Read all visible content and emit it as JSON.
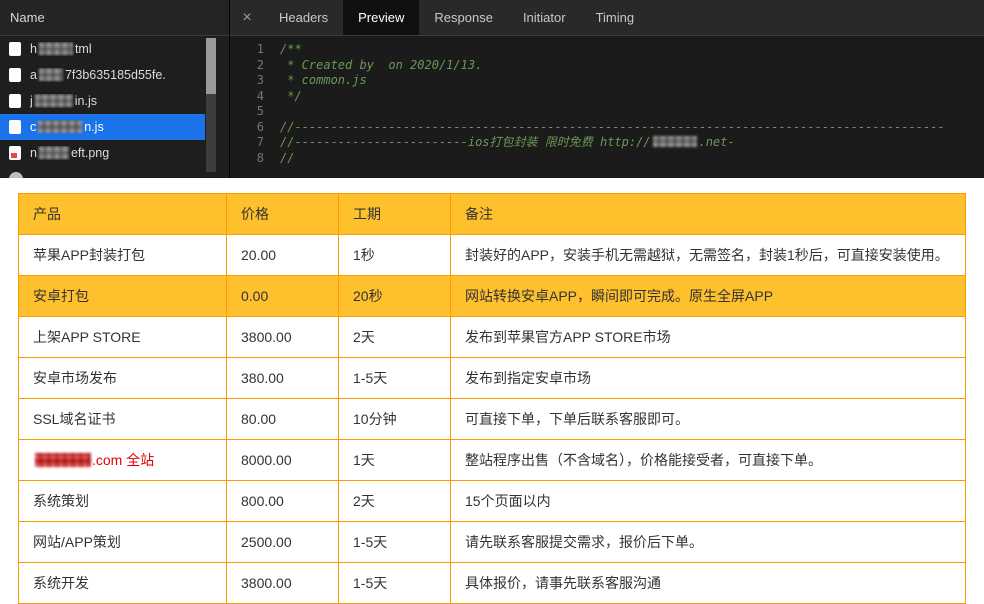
{
  "colors": {
    "selection_blue": "#1a73e8",
    "table_border": "#ff9900",
    "table_header_bg": "#ffc02e",
    "highlight_row_bg": "#ffc02e",
    "red_text": "#e60000",
    "comment_green": "#6a9955"
  },
  "devtools": {
    "panel_header": "Name",
    "tabs": {
      "close_icon": "×",
      "items": [
        "Headers",
        "Preview",
        "Response",
        "Initiator",
        "Timing"
      ],
      "active": "Preview"
    },
    "files": [
      {
        "icon": "doc",
        "selected": false,
        "parts": [
          {
            "text": "h"
          },
          {
            "blur": 34
          },
          {
            "text": "tml"
          }
        ]
      },
      {
        "icon": "doc",
        "selected": false,
        "parts": [
          {
            "text": "a"
          },
          {
            "blur": 24
          },
          {
            "text": "7f3b635185d55fe."
          }
        ]
      },
      {
        "icon": "doc",
        "selected": false,
        "parts": [
          {
            "text": "j"
          },
          {
            "blur": 38
          },
          {
            "text": "in.js"
          }
        ]
      },
      {
        "icon": "doc",
        "selected": true,
        "parts": [
          {
            "text": "c"
          },
          {
            "blur": 44
          },
          {
            "text": "n.js"
          }
        ]
      },
      {
        "icon": "img",
        "selected": false,
        "parts": [
          {
            "text": "n"
          },
          {
            "blur": 30
          },
          {
            "text": "eft.png"
          }
        ]
      },
      {
        "icon": "circle",
        "selected": false,
        "parts": []
      }
    ],
    "code": {
      "lines": [
        {
          "n": 1,
          "text": "/**"
        },
        {
          "n": 2,
          "text": " * Created by  on 2020/1/13."
        },
        {
          "n": 3,
          "text": " * common.js"
        },
        {
          "n": 4,
          "text": " */"
        },
        {
          "n": 5,
          "text": ""
        },
        {
          "n": 6,
          "text": "//------------------------------------------------------------------------------------------"
        },
        {
          "n": 7,
          "parts": [
            {
              "text": "//------------------------ios打包封装 限时免费 http://"
            },
            {
              "blur": 44
            },
            {
              "text": ".net-"
            }
          ]
        },
        {
          "n": 8,
          "text": "//"
        }
      ]
    }
  },
  "pricing_table": {
    "headers": [
      "产品",
      "价格",
      "工期",
      "备注"
    ],
    "rows": [
      {
        "cells": [
          "苹果APP封装打包",
          "20.00",
          "1秒",
          "封装好的APP，安装手机无需越狱，无需签名，封装1秒后，可直接安装使用。"
        ]
      },
      {
        "cells": [
          "安卓打包",
          "0.00",
          "20秒",
          "网站转换安卓APP，瞬间即可完成。原生全屏APP"
        ],
        "highlight": true
      },
      {
        "cells": [
          "上架APP STORE",
          "3800.00",
          "2天",
          "发布到苹果官方APP STORE市场"
        ]
      },
      {
        "cells": [
          "安卓市场发布",
          "380.00",
          "1-5天",
          "发布到指定安卓市场"
        ]
      },
      {
        "cells": [
          "SSL域名证书",
          "80.00",
          "10分钟",
          "可直接下单，下单后联系客服即可。"
        ]
      },
      {
        "cells": [
          ".com 全站",
          "8000.00",
          "1天",
          "整站程序出售（不含域名），价格能接受者，可直接下单。"
        ],
        "red": true,
        "blur_prefix": 56
      },
      {
        "cells": [
          "系统策划",
          "800.00",
          "2天",
          "15个页面以内"
        ]
      },
      {
        "cells": [
          "网站/APP策划",
          "2500.00",
          "1-5天",
          "请先联系客服提交需求，报价后下单。"
        ]
      },
      {
        "cells": [
          "系统开发",
          "3800.00",
          "1-5天",
          "具体报价，请事先联系客服沟通"
        ]
      }
    ]
  }
}
